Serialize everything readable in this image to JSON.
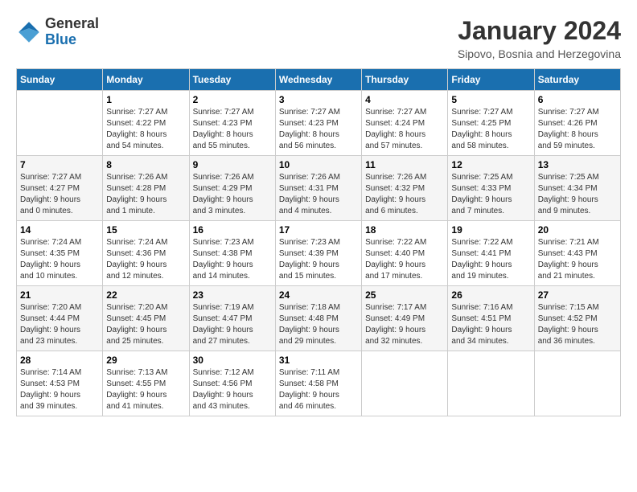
{
  "header": {
    "logo_general": "General",
    "logo_blue": "Blue",
    "month_year": "January 2024",
    "location": "Sipovo, Bosnia and Herzegovina"
  },
  "days_of_week": [
    "Sunday",
    "Monday",
    "Tuesday",
    "Wednesday",
    "Thursday",
    "Friday",
    "Saturday"
  ],
  "weeks": [
    [
      {
        "day": "",
        "info": ""
      },
      {
        "day": "1",
        "info": "Sunrise: 7:27 AM\nSunset: 4:22 PM\nDaylight: 8 hours\nand 54 minutes."
      },
      {
        "day": "2",
        "info": "Sunrise: 7:27 AM\nSunset: 4:23 PM\nDaylight: 8 hours\nand 55 minutes."
      },
      {
        "day": "3",
        "info": "Sunrise: 7:27 AM\nSunset: 4:23 PM\nDaylight: 8 hours\nand 56 minutes."
      },
      {
        "day": "4",
        "info": "Sunrise: 7:27 AM\nSunset: 4:24 PM\nDaylight: 8 hours\nand 57 minutes."
      },
      {
        "day": "5",
        "info": "Sunrise: 7:27 AM\nSunset: 4:25 PM\nDaylight: 8 hours\nand 58 minutes."
      },
      {
        "day": "6",
        "info": "Sunrise: 7:27 AM\nSunset: 4:26 PM\nDaylight: 8 hours\nand 59 minutes."
      }
    ],
    [
      {
        "day": "7",
        "info": "Sunrise: 7:27 AM\nSunset: 4:27 PM\nDaylight: 9 hours\nand 0 minutes."
      },
      {
        "day": "8",
        "info": "Sunrise: 7:26 AM\nSunset: 4:28 PM\nDaylight: 9 hours\nand 1 minute."
      },
      {
        "day": "9",
        "info": "Sunrise: 7:26 AM\nSunset: 4:29 PM\nDaylight: 9 hours\nand 3 minutes."
      },
      {
        "day": "10",
        "info": "Sunrise: 7:26 AM\nSunset: 4:31 PM\nDaylight: 9 hours\nand 4 minutes."
      },
      {
        "day": "11",
        "info": "Sunrise: 7:26 AM\nSunset: 4:32 PM\nDaylight: 9 hours\nand 6 minutes."
      },
      {
        "day": "12",
        "info": "Sunrise: 7:25 AM\nSunset: 4:33 PM\nDaylight: 9 hours\nand 7 minutes."
      },
      {
        "day": "13",
        "info": "Sunrise: 7:25 AM\nSunset: 4:34 PM\nDaylight: 9 hours\nand 9 minutes."
      }
    ],
    [
      {
        "day": "14",
        "info": "Sunrise: 7:24 AM\nSunset: 4:35 PM\nDaylight: 9 hours\nand 10 minutes."
      },
      {
        "day": "15",
        "info": "Sunrise: 7:24 AM\nSunset: 4:36 PM\nDaylight: 9 hours\nand 12 minutes."
      },
      {
        "day": "16",
        "info": "Sunrise: 7:23 AM\nSunset: 4:38 PM\nDaylight: 9 hours\nand 14 minutes."
      },
      {
        "day": "17",
        "info": "Sunrise: 7:23 AM\nSunset: 4:39 PM\nDaylight: 9 hours\nand 15 minutes."
      },
      {
        "day": "18",
        "info": "Sunrise: 7:22 AM\nSunset: 4:40 PM\nDaylight: 9 hours\nand 17 minutes."
      },
      {
        "day": "19",
        "info": "Sunrise: 7:22 AM\nSunset: 4:41 PM\nDaylight: 9 hours\nand 19 minutes."
      },
      {
        "day": "20",
        "info": "Sunrise: 7:21 AM\nSunset: 4:43 PM\nDaylight: 9 hours\nand 21 minutes."
      }
    ],
    [
      {
        "day": "21",
        "info": "Sunrise: 7:20 AM\nSunset: 4:44 PM\nDaylight: 9 hours\nand 23 minutes."
      },
      {
        "day": "22",
        "info": "Sunrise: 7:20 AM\nSunset: 4:45 PM\nDaylight: 9 hours\nand 25 minutes."
      },
      {
        "day": "23",
        "info": "Sunrise: 7:19 AM\nSunset: 4:47 PM\nDaylight: 9 hours\nand 27 minutes."
      },
      {
        "day": "24",
        "info": "Sunrise: 7:18 AM\nSunset: 4:48 PM\nDaylight: 9 hours\nand 29 minutes."
      },
      {
        "day": "25",
        "info": "Sunrise: 7:17 AM\nSunset: 4:49 PM\nDaylight: 9 hours\nand 32 minutes."
      },
      {
        "day": "26",
        "info": "Sunrise: 7:16 AM\nSunset: 4:51 PM\nDaylight: 9 hours\nand 34 minutes."
      },
      {
        "day": "27",
        "info": "Sunrise: 7:15 AM\nSunset: 4:52 PM\nDaylight: 9 hours\nand 36 minutes."
      }
    ],
    [
      {
        "day": "28",
        "info": "Sunrise: 7:14 AM\nSunset: 4:53 PM\nDaylight: 9 hours\nand 39 minutes."
      },
      {
        "day": "29",
        "info": "Sunrise: 7:13 AM\nSunset: 4:55 PM\nDaylight: 9 hours\nand 41 minutes."
      },
      {
        "day": "30",
        "info": "Sunrise: 7:12 AM\nSunset: 4:56 PM\nDaylight: 9 hours\nand 43 minutes."
      },
      {
        "day": "31",
        "info": "Sunrise: 7:11 AM\nSunset: 4:58 PM\nDaylight: 9 hours\nand 46 minutes."
      },
      {
        "day": "",
        "info": ""
      },
      {
        "day": "",
        "info": ""
      },
      {
        "day": "",
        "info": ""
      }
    ]
  ]
}
